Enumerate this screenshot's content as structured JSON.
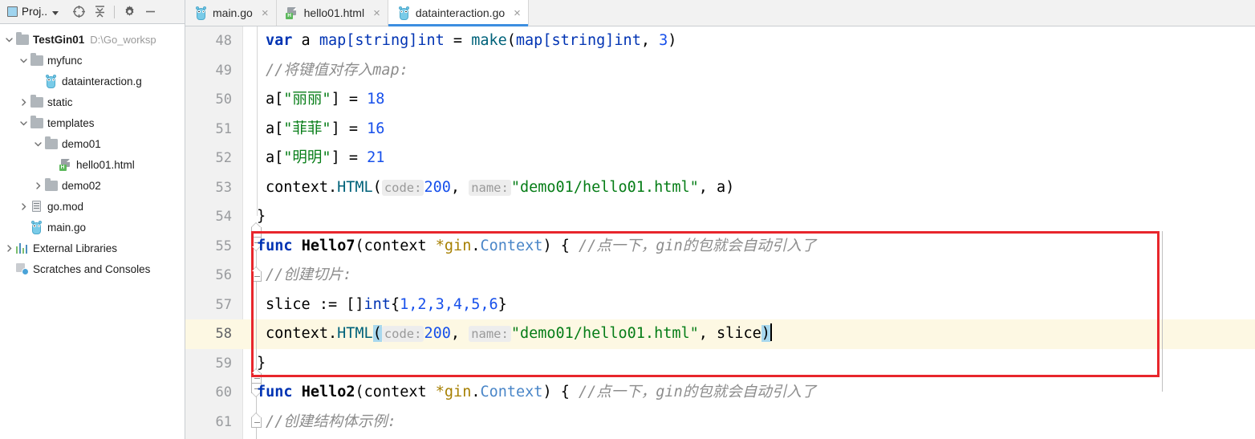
{
  "panel": {
    "title": "Proj..",
    "icons": [
      {
        "name": "locate-icon",
        "glyph": "locate"
      },
      {
        "name": "collapse-all-icon",
        "glyph": "collapse"
      },
      {
        "name": "settings-gear-icon",
        "glyph": "gear"
      },
      {
        "name": "hide-panel-icon",
        "glyph": "minus"
      }
    ],
    "tree": [
      {
        "label": "TestGin01",
        "sub": "D:\\Go_worksp",
        "indent": 0,
        "arrow": "down",
        "icon": "folder",
        "bold": true
      },
      {
        "label": "myfunc",
        "sub": "",
        "indent": 1,
        "arrow": "down",
        "icon": "folder",
        "bold": false
      },
      {
        "label": "datainteraction.g",
        "sub": "",
        "indent": 2,
        "arrow": "none",
        "icon": "go",
        "bold": false
      },
      {
        "label": "static",
        "sub": "",
        "indent": 1,
        "arrow": "right",
        "icon": "folder",
        "bold": false
      },
      {
        "label": "templates",
        "sub": "",
        "indent": 1,
        "arrow": "down",
        "icon": "folder",
        "bold": false
      },
      {
        "label": "demo01",
        "sub": "",
        "indent": 2,
        "arrow": "down",
        "icon": "folder",
        "bold": false
      },
      {
        "label": "hello01.html",
        "sub": "",
        "indent": 3,
        "arrow": "none",
        "icon": "html",
        "bold": false
      },
      {
        "label": "demo02",
        "sub": "",
        "indent": 2,
        "arrow": "right",
        "icon": "folder",
        "bold": false
      },
      {
        "label": "go.mod",
        "sub": "",
        "indent": 1,
        "arrow": "right",
        "icon": "doc",
        "bold": false
      },
      {
        "label": "main.go",
        "sub": "",
        "indent": 1,
        "arrow": "none",
        "icon": "go",
        "bold": false
      },
      {
        "label": "External Libraries",
        "sub": "",
        "indent": 0,
        "arrow": "right",
        "icon": "lib",
        "bold": false
      },
      {
        "label": "Scratches and Consoles",
        "sub": "",
        "indent": 0,
        "arrow": "none",
        "icon": "scratch",
        "bold": false
      }
    ]
  },
  "tabs": [
    {
      "label": "main.go",
      "icon": "go",
      "active": false,
      "close": "×"
    },
    {
      "label": "hello01.html",
      "icon": "html",
      "active": false,
      "close": "×"
    },
    {
      "label": "datainteraction.go",
      "icon": "go",
      "active": true,
      "close": "×"
    }
  ],
  "editor": {
    "current_line": 58,
    "lines": [
      {
        "num": "48"
      },
      {
        "num": "49"
      },
      {
        "num": "50"
      },
      {
        "num": "51"
      },
      {
        "num": "52"
      },
      {
        "num": "53"
      },
      {
        "num": "54"
      },
      {
        "num": "55"
      },
      {
        "num": "56"
      },
      {
        "num": "57"
      },
      {
        "num": "58"
      },
      {
        "num": "59"
      },
      {
        "num": "60"
      },
      {
        "num": "61"
      }
    ],
    "code": {
      "l48_kw": "var",
      "l48_a": " a ",
      "l48_maptype": "map[string]int",
      "l48_eq": " = ",
      "l48_make": "make",
      "l48_p1": "(",
      "l48_maptype2": "map[string]int",
      "l48_comma": ", ",
      "l48_3": "3",
      "l48_p2": ")",
      "l49_comment": "//将键值对存入map:",
      "l50_pre": "a[",
      "l50_str": "\"丽丽\"",
      "l50_post": "] = ",
      "l50_num": "18",
      "l51_pre": "a[",
      "l51_str": "\"菲菲\"",
      "l51_post": "] = ",
      "l51_num": "16",
      "l52_pre": "a[",
      "l52_str": "\"明明\"",
      "l52_post": "] = ",
      "l52_num": "21",
      "l53_ctx": "context",
      "l53_dot": ".",
      "l53_html": "HTML",
      "l53_paren": "(",
      "l53_hint1": "code:",
      "l53_200": "200",
      "l53_comma": ", ",
      "l53_hint2": "name:",
      "l53_str": "\"demo01/hello01.html\"",
      "l53_tail": ", a)",
      "l54_brace": "}",
      "l55_func": "func",
      "l55_name": " Hello7",
      "l55_p1": "(",
      "l55_ctx": "context ",
      "l55_star": "*gin",
      "l55_dot": ".",
      "l55_type": "Context",
      "l55_p2": ") { ",
      "l55_comment": "//点一下，gin的包就会自动引入了",
      "l56_comment": "//创建切片:",
      "l57_name": "slice ",
      "l57_assign": ":= []",
      "l57_int": "int",
      "l57_brace1": "{",
      "l57_nums": "1,2,3,4,5,6",
      "l57_brace2": "}",
      "l58_ctx": "context",
      "l58_dot": ".",
      "l58_html": "HTML",
      "l58_paren": "(",
      "l58_hint1": "code:",
      "l58_200": "200",
      "l58_comma": ", ",
      "l58_hint2": "name:",
      "l58_str": "\"demo01/hello01.html\"",
      "l58_slice": ", slice",
      "l58_paren2": ")",
      "l59_brace": "}",
      "l60_func": "func",
      "l60_name": " Hello2",
      "l60_p1": "(",
      "l60_ctx": "context ",
      "l60_star": "*gin",
      "l60_dot": ".",
      "l60_type": "Context",
      "l60_p2": ") { ",
      "l60_comment": "//点一下，gin的包就会自动引入了",
      "l61_comment": "//创建结构体示例:"
    }
  },
  "annotation": {
    "color": "#e8262c",
    "label": "highlighted-region-lines-55-59"
  }
}
